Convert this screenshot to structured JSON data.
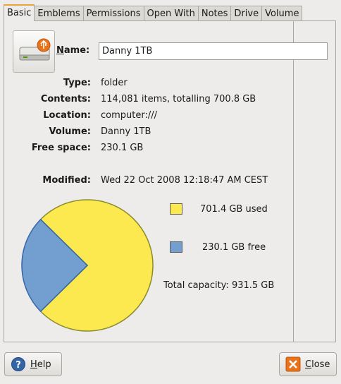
{
  "tabs": [
    "Basic",
    "Emblems",
    "Permissions",
    "Open With",
    "Notes",
    "Drive",
    "Volume"
  ],
  "name_label": "Name:",
  "name_value": "Danny 1TB",
  "rows": [
    {
      "label": "Type:",
      "value": "folder"
    },
    {
      "label": "Contents:",
      "value": "114,081 items, totalling 700.8 GB"
    },
    {
      "label": "Location:",
      "value": "computer:///"
    },
    {
      "label": "Volume:",
      "value": "Danny 1TB"
    },
    {
      "label": "Free space:",
      "value": "230.1 GB"
    }
  ],
  "modified": {
    "label": "Modified:",
    "value": "Wed 22 Oct 2008 12:18:47 AM CEST"
  },
  "usage": {
    "used_text": "701.4 GB used",
    "free_text": "230.1 GB free",
    "total_text": "Total capacity: 931.5 GB",
    "used_gb": 701.4,
    "free_gb": 230.1,
    "used_color": "#fce94f",
    "free_color": "#729fcf"
  },
  "buttons": {
    "help": "Help",
    "close": "Close"
  }
}
